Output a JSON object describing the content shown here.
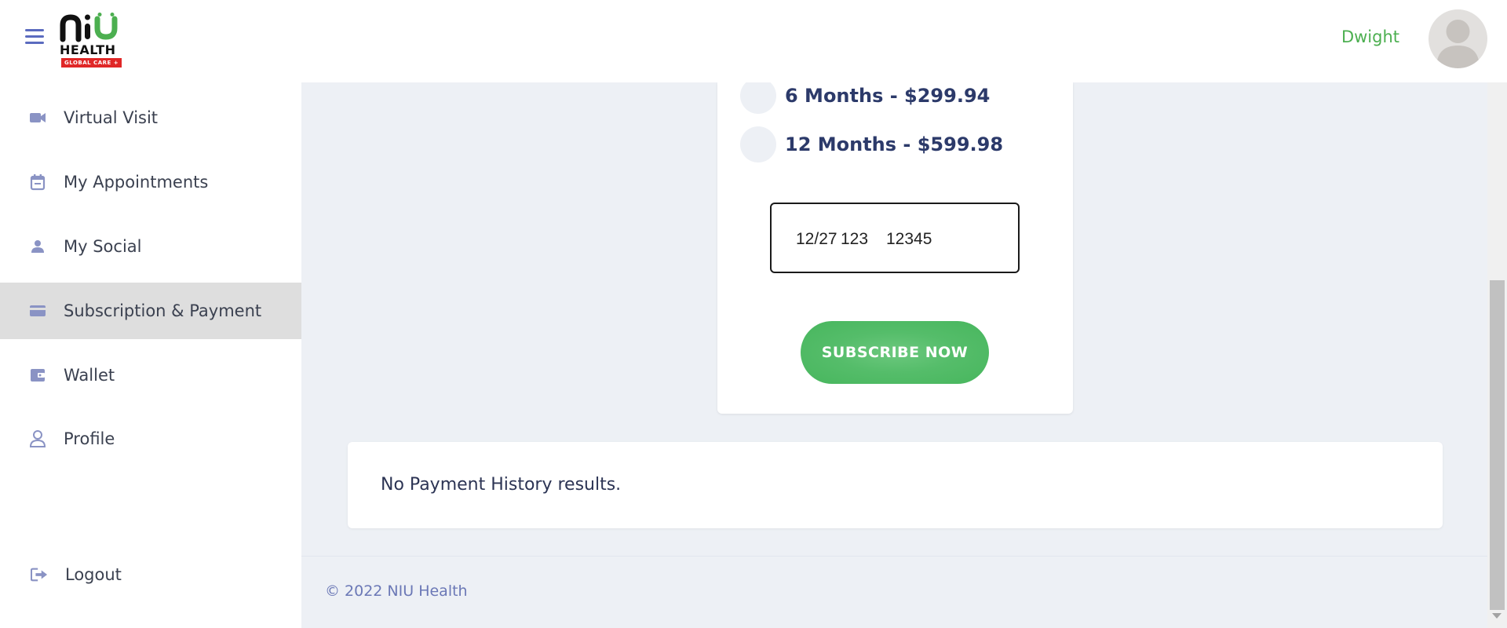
{
  "header": {
    "logo": {
      "brand": "NIU",
      "subtitle": "HEALTH",
      "tagline": "GLOBAL CARE +"
    },
    "user_name": "Dwight"
  },
  "sidebar": {
    "items": [
      {
        "label": "Virtual Visit",
        "icon": "video-camera-icon",
        "active": false
      },
      {
        "label": "My Appointments",
        "icon": "calendar-icon",
        "active": false
      },
      {
        "label": "My Social",
        "icon": "person-icon",
        "active": false
      },
      {
        "label": "Subscription & Payment",
        "icon": "credit-card-icon",
        "active": true
      },
      {
        "label": "Wallet",
        "icon": "wallet-icon",
        "active": false
      },
      {
        "label": "Profile",
        "icon": "user-outline-icon",
        "active": false
      }
    ],
    "logout_label": "Logout",
    "logout_icon": "logout-icon"
  },
  "subscription": {
    "plans": [
      {
        "label": "6 Months - $299.94",
        "selected": false
      },
      {
        "label": "12 Months - $599.98",
        "selected": false
      }
    ],
    "card_field": {
      "expiry": "12/27",
      "cvc": "123",
      "zip": "12345"
    },
    "subscribe_label": "SUBSCRIBE NOW"
  },
  "payment_history": {
    "empty_message": "No Payment History results."
  },
  "footer": {
    "copyright": "© 2022 NIU Health"
  },
  "colors": {
    "accent_green": "#4caf50",
    "button_green": "#47b65d",
    "nav_icon": "#8a93c4",
    "text_navy": "#2c3a6a",
    "page_bg": "#edf0f5"
  }
}
